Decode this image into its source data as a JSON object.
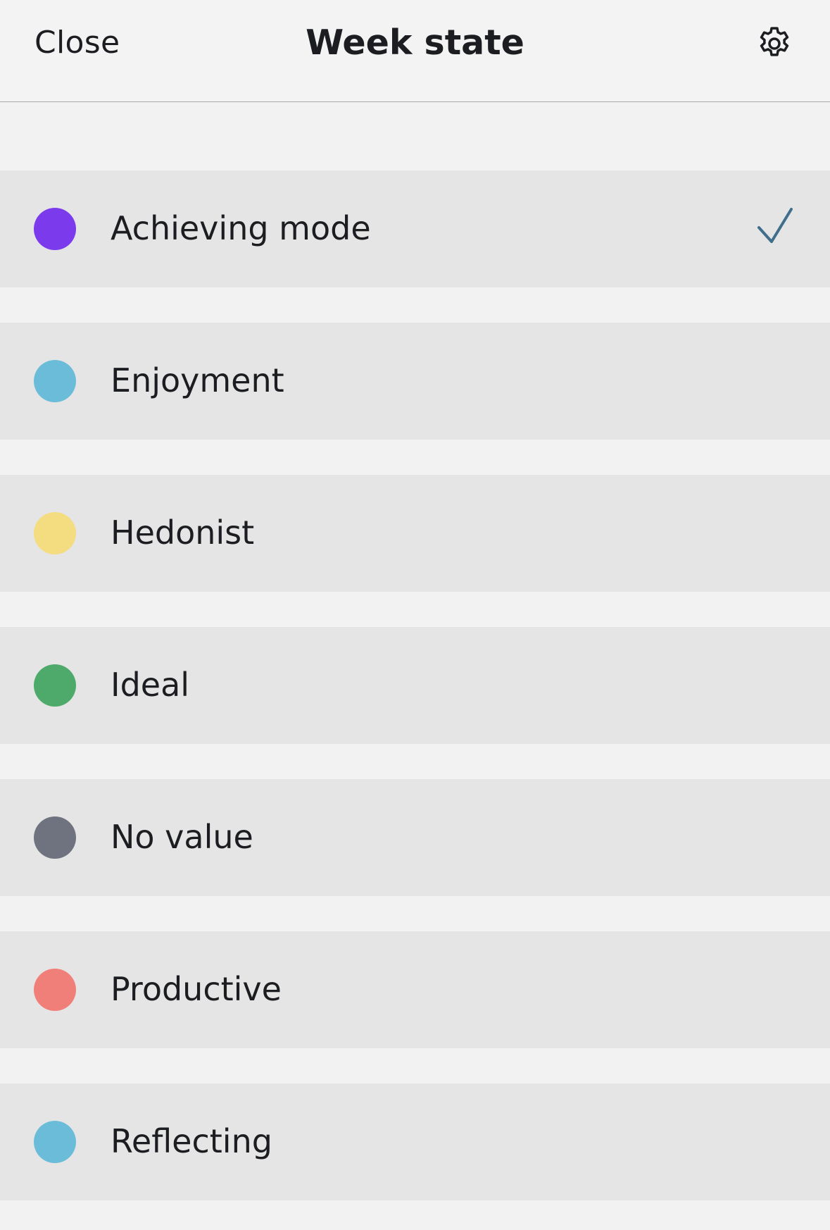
{
  "header": {
    "close_label": "Close",
    "title": "Week state",
    "settings_icon": "gear-icon"
  },
  "items": [
    {
      "label": "Achieving mode",
      "color": "#7c3aed",
      "selected": true
    },
    {
      "label": "Enjoyment",
      "color": "#6bbcd9",
      "selected": false
    },
    {
      "label": "Hedonist",
      "color": "#f4dc80",
      "selected": false
    },
    {
      "label": "Ideal",
      "color": "#4daa6b",
      "selected": false
    },
    {
      "label": "No value",
      "color": "#6f7380",
      "selected": false
    },
    {
      "label": "Productive",
      "color": "#f17f79",
      "selected": false
    },
    {
      "label": "Reflecting",
      "color": "#6bbcd9",
      "selected": false
    }
  ],
  "selected_icon": "checkmark-icon",
  "accent_color": "#3f6f8c"
}
